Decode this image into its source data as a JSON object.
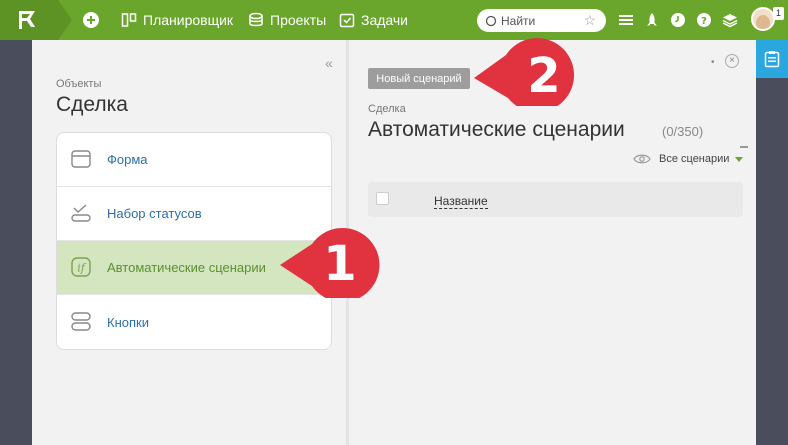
{
  "topbar": {
    "nav": [
      {
        "label": "Планировщик",
        "icon": "planner-icon"
      },
      {
        "label": "Проекты",
        "icon": "projects-icon"
      },
      {
        "label": "Задачи",
        "icon": "tasks-icon"
      }
    ],
    "search_placeholder": "Найти",
    "notification_count": "1",
    "colors": {
      "bar": "#6aa62c",
      "logo": "#5d9324"
    }
  },
  "left": {
    "crumb": "Объекты",
    "title": "Сделка",
    "items": [
      {
        "label": "Форма",
        "icon": "form-icon"
      },
      {
        "label": "Набор статусов",
        "icon": "statuses-icon"
      },
      {
        "label": "Автоматические сценарии",
        "icon": "function-icon",
        "active": true
      },
      {
        "label": "Кнопки",
        "icon": "buttons-icon"
      }
    ]
  },
  "right": {
    "new_button": "Новый сценарий",
    "crumb": "Сделка",
    "title": "Автоматические сценарии",
    "count": "(0/350)",
    "filter": "Все сценарии",
    "columns": [
      "Название"
    ]
  },
  "callouts": [
    {
      "number": "1",
      "color": "#e0333f"
    },
    {
      "number": "2",
      "color": "#e0333f"
    }
  ]
}
